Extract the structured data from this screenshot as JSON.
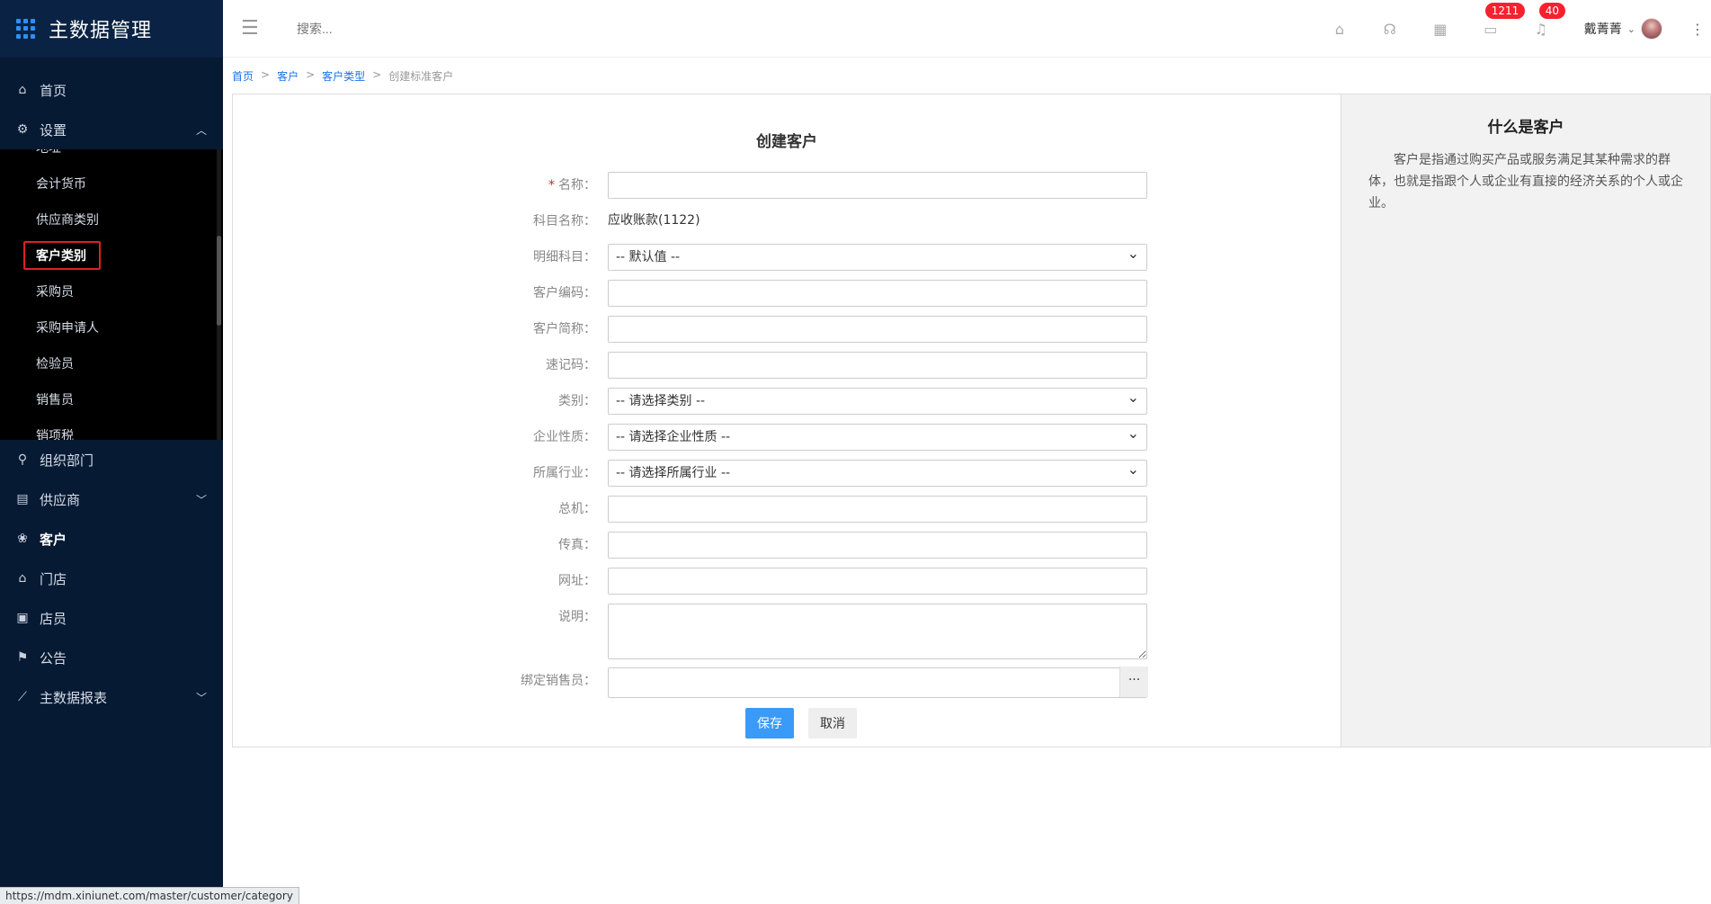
{
  "app": {
    "title": "主数据管理"
  },
  "sidebar": {
    "top_items": [
      {
        "label": "首页",
        "icon": "home-icon"
      },
      {
        "label": "设置",
        "icon": "gear-icon"
      }
    ],
    "settings_submenu": [
      "地址",
      "会计货币",
      "供应商类别",
      "客户类别",
      "采购员",
      "采购申请人",
      "检验员",
      "销售员",
      "销项税"
    ],
    "bottom_items": [
      {
        "label": "组织部门",
        "icon": "org-icon"
      },
      {
        "label": "供应商",
        "icon": "supplier-icon"
      },
      {
        "label": "客户",
        "icon": "customer-icon"
      },
      {
        "label": "门店",
        "icon": "store-icon"
      },
      {
        "label": "店员",
        "icon": "staff-icon"
      },
      {
        "label": "公告",
        "icon": "announcement-icon"
      },
      {
        "label": "主数据报表",
        "icon": "report-icon"
      }
    ],
    "status_url": "https://mdm.xiniunet.com/master/customer/category"
  },
  "header": {
    "search_placeholder": "搜索...",
    "badge_tasks": "1211",
    "badge_notifications": "40",
    "user_name": "戴菁菁"
  },
  "breadcrumb": [
    "首页",
    "客户",
    "客户类型",
    "创建标准客户"
  ],
  "form": {
    "title": "创建客户",
    "fields": {
      "name_label": "名称：",
      "account_label": "科目名称：",
      "account_value": "应收账款(1122)",
      "detail_label": "明细科目：",
      "detail_value": "-- 默认值 --",
      "code_label": "客户编码：",
      "short_label": "客户简称：",
      "quick_label": "速记码：",
      "category_label": "类别：",
      "category_value": "-- 请选择类别 --",
      "nature_label": "企业性质：",
      "nature_value": "-- 请选择企业性质 --",
      "industry_label": "所属行业：",
      "industry_value": "-- 请选择所属行业 --",
      "phone_label": "总机：",
      "fax_label": "传真：",
      "website_label": "网址：",
      "desc_label": "说明：",
      "salesman_label": "绑定销售员："
    },
    "save_label": "保存",
    "cancel_label": "取消"
  },
  "info": {
    "title": "什么是客户",
    "text": "客户是指通过购买产品或服务满足其某种需求的群体，也就是指跟个人或企业有直接的经济关系的个人或企业。"
  }
}
